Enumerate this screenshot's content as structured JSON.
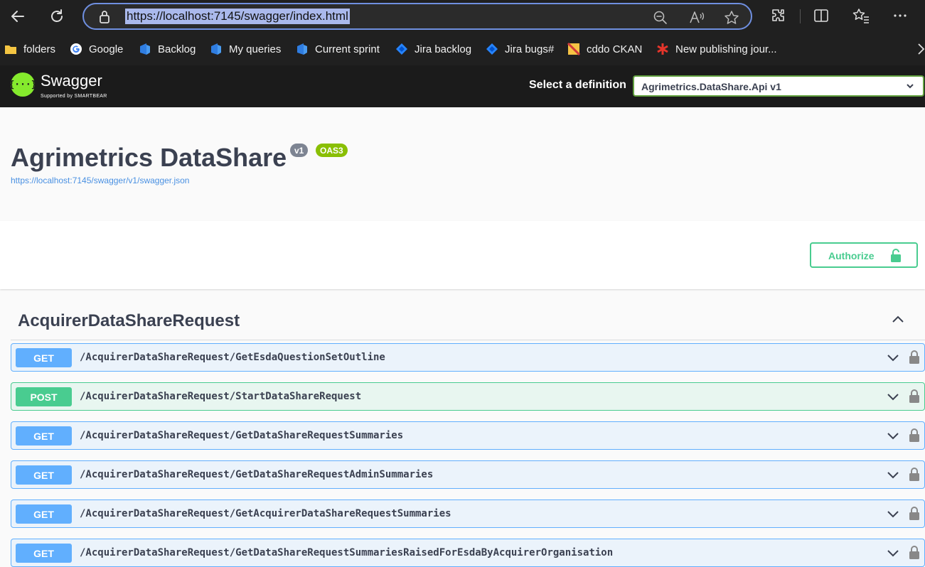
{
  "browser": {
    "url": "https://localhost:7145/swagger/index.html",
    "bookmarks": [
      {
        "label": "folders",
        "icon": "folder-icon"
      },
      {
        "label": "Google",
        "icon": "google-icon"
      },
      {
        "label": "Backlog",
        "icon": "azure-devops-icon"
      },
      {
        "label": "My queries",
        "icon": "azure-devops-icon"
      },
      {
        "label": "Current sprint",
        "icon": "azure-devops-icon"
      },
      {
        "label": "Jira backlog",
        "icon": "jira-icon"
      },
      {
        "label": "Jira bugs#",
        "icon": "jira-icon"
      },
      {
        "label": "cddo CKAN",
        "icon": "ckan-icon"
      },
      {
        "label": "New publishing jour...",
        "icon": "asterisk-icon"
      }
    ]
  },
  "swagger": {
    "logo_name": "Swagger",
    "logo_sub": "Supported by SMARTBEAR",
    "select_definition_label": "Select a definition",
    "selected_definition": "Agrimetrics.DataShare.Api v1"
  },
  "info": {
    "title": "Agrimetrics DataShare",
    "version_badge": "v1",
    "oas_badge": "OAS3",
    "json_link": "https://localhost:7145/swagger/v1/swagger.json"
  },
  "authorize_label": "Authorize",
  "tag": {
    "name": "AcquirerDataShareRequest",
    "operations": [
      {
        "method": "GET",
        "path": "/AcquirerDataShareRequest/GetEsdaQuestionSetOutline"
      },
      {
        "method": "POST",
        "path": "/AcquirerDataShareRequest/StartDataShareRequest"
      },
      {
        "method": "GET",
        "path": "/AcquirerDataShareRequest/GetDataShareRequestSummaries"
      },
      {
        "method": "GET",
        "path": "/AcquirerDataShareRequest/GetDataShareRequestAdminSummaries"
      },
      {
        "method": "GET",
        "path": "/AcquirerDataShareRequest/GetAcquirerDataShareRequestSummaries"
      },
      {
        "method": "GET",
        "path": "/AcquirerDataShareRequest/GetDataShareRequestSummariesRaisedForEsdaByAcquirerOrganisation"
      }
    ]
  },
  "colors": {
    "get": "#61affe",
    "post": "#49cc90",
    "swagger_green": "#85ea2d",
    "address_border": "#6f8fe0"
  }
}
